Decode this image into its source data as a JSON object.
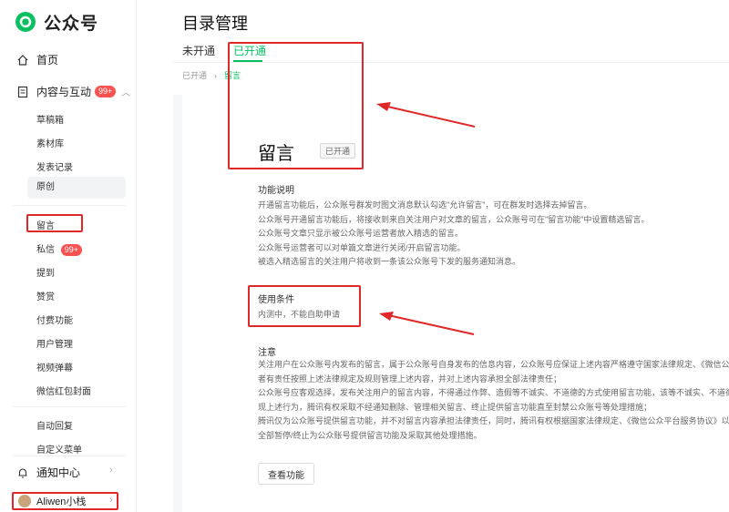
{
  "brand": {
    "name": "公众号",
    "accent": "#07c160"
  },
  "sidebar": {
    "home": "首页",
    "content": {
      "label": "内容与互动",
      "badge": "99+"
    },
    "content_items": [
      "草稿箱",
      "素材库",
      "发表记录",
      "原创"
    ],
    "items": [
      {
        "label": "留言"
      },
      {
        "label": "私信",
        "badge": "99+"
      },
      {
        "label": "提到"
      },
      {
        "label": "赞赏"
      },
      {
        "label": "付费功能"
      },
      {
        "label": "用户管理"
      },
      {
        "label": "视频弹幕"
      },
      {
        "label": "微信红包封面"
      }
    ],
    "items2": [
      "自动回复",
      "自定义菜单"
    ],
    "notify": "通知中心",
    "user": "Aliwen小栈"
  },
  "header": {
    "title": "目录管理"
  },
  "tabs": [
    {
      "label": "未开通"
    },
    {
      "label": "已开通"
    }
  ],
  "breadcrumb": {
    "parent": "已开通",
    "current": "留言"
  },
  "detail": {
    "title": "留言",
    "status": "已开通",
    "func_title": "功能说明",
    "func_lines": [
      "开通留言功能后，公众账号群发时图文消息默认勾选\"允许留言\"，可在群发时选择去掉留言。",
      "公众账号开通留言功能后，将接收到来自关注用户对文章的留言，公众账号可在\"留言功能\"中设置精选留言。",
      "公众账号文章只显示被公众账号运营者放入精选的留言。",
      "公众账号运营者可以对单篇文章进行关闭/开启留言功能。",
      "被选入精选留言的关注用户将收到一条该公众账号下发的服务通知消息。"
    ],
    "cond_title": "使用条件",
    "cond_text": "内测中，不能自助申请",
    "note_title": "注意",
    "note_lines": [
      "关注用户在公众账号内发布的留言，属于公众账号自身发布的信息内容，公众账号应保证上述内容严格遵守国家法律规定、《微信公",
      "者有责任按照上述法律规定及规则管理上述内容，并对上述内容承担全部法律责任；",
      "公众账号应客观选择，发布关注用户的留言内容，不得通过作弊、造假等不诚实、不道德的方式使用留言功能，该等不诚实、不道德",
      "现上述行为，腾讯有权采取不经通知删除、管理相关留言、终止提供留言功能直至封禁公众账号等处理措施；",
      "腾讯仅为公众账号提供留言功能，并不对留言内容承担法律责任，同时，腾讯有权根据国家法律规定、《微信公众平台服务协议》以",
      "全部暂停/终止为公众账号提供留言功能及采取其他处理措施。"
    ],
    "button": "查看功能"
  },
  "colors": {
    "annotation": "#e02828",
    "active": "#07c160"
  }
}
